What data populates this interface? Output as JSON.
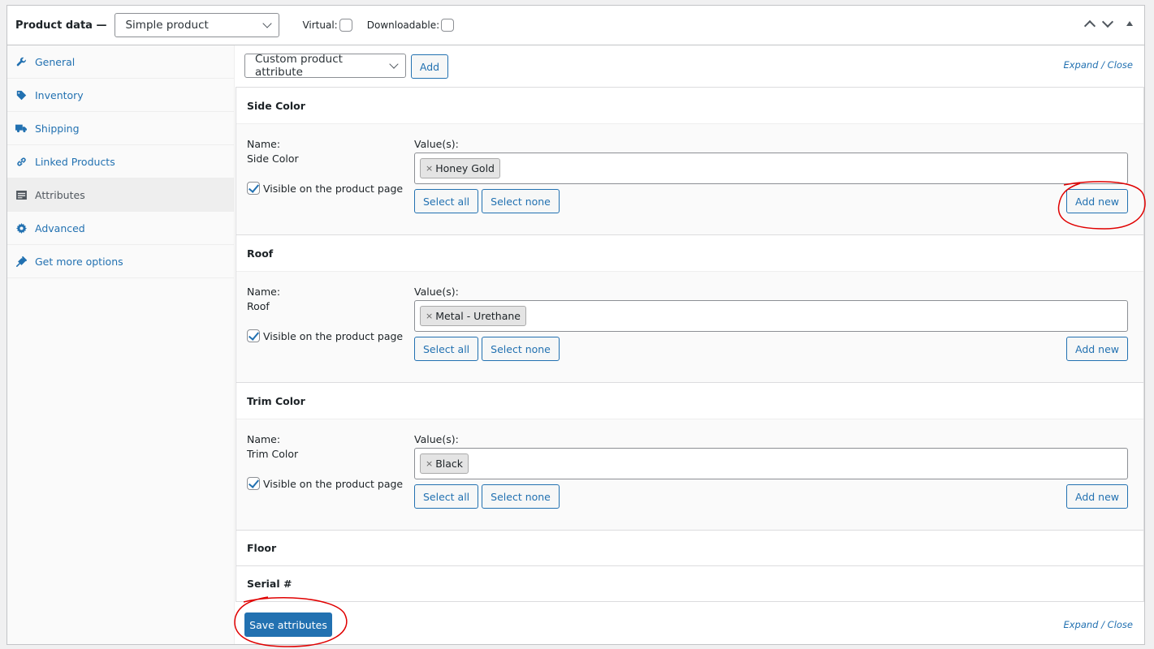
{
  "header": {
    "title": "Product data —",
    "product_type": "Simple product",
    "virtual_label": "Virtual:",
    "downloadable_label": "Downloadable:",
    "virtual_checked": false,
    "downloadable_checked": false
  },
  "sidebar": {
    "items": [
      {
        "label": "General",
        "icon": "wrench-icon",
        "active": false
      },
      {
        "label": "Inventory",
        "icon": "tag-icon",
        "active": false
      },
      {
        "label": "Shipping",
        "icon": "truck-icon",
        "active": false
      },
      {
        "label": "Linked Products",
        "icon": "link-icon",
        "active": false
      },
      {
        "label": "Attributes",
        "icon": "list-icon",
        "active": true
      },
      {
        "label": "Advanced",
        "icon": "gear-icon",
        "active": false
      },
      {
        "label": "Get more options",
        "icon": "plugin-icon",
        "active": false
      }
    ]
  },
  "toolbar": {
    "attribute_select": "Custom product attribute",
    "add_label": "Add",
    "expand": "Expand",
    "separator": "/",
    "close": "Close"
  },
  "attributes": [
    {
      "title": "Side Color",
      "name_label": "Name:",
      "name": "Side Color",
      "visible_label": "Visible on the product page",
      "values_label": "Value(s):",
      "token": "Honey Gold",
      "select_all": "Select all",
      "select_none": "Select none",
      "add_new": "Add new"
    },
    {
      "title": "Roof",
      "name_label": "Name:",
      "name": "Roof",
      "visible_label": "Visible on the product page",
      "values_label": "Value(s):",
      "token": "Metal - Urethane",
      "select_all": "Select all",
      "select_none": "Select none",
      "add_new": "Add new"
    },
    {
      "title": "Trim Color",
      "name_label": "Name:",
      "name": "Trim Color",
      "visible_label": "Visible on the product page",
      "values_label": "Value(s):",
      "token": "Black",
      "select_all": "Select all",
      "select_none": "Select none",
      "add_new": "Add new"
    }
  ],
  "collapsed_attributes": [
    "Floor",
    "Serial #"
  ],
  "token_remove": "×",
  "footer": {
    "save_label": "Save attributes",
    "expand": "Expand",
    "separator": "/",
    "close": "Close"
  },
  "colors": {
    "accent": "#2271b1",
    "annotation": "#e00000"
  }
}
